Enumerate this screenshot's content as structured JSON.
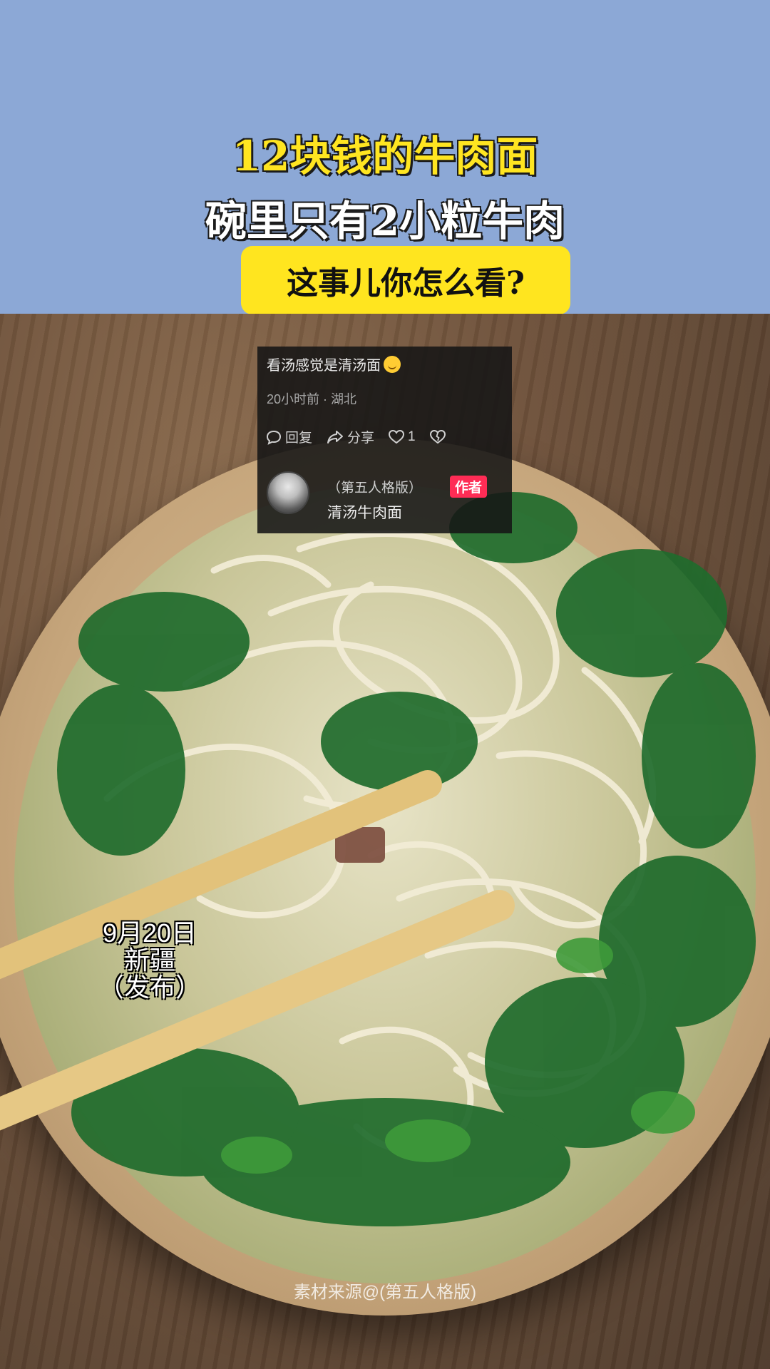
{
  "header": {
    "line1": "12块钱的牛肉面",
    "line2": "碗里只有2小粒牛肉",
    "question": "这事儿你怎么看?"
  },
  "comment": {
    "text": "看汤感觉是清汤面",
    "emoji_icon": "grin-emoji-icon",
    "meta": "20小时前 · 湖北",
    "actions": {
      "reply_label": "回复",
      "share_label": "分享",
      "like_count": "1"
    },
    "reply": {
      "author": "（第五人格版）",
      "badge": "作者",
      "text": "清汤牛肉面"
    }
  },
  "caption": {
    "date": "9月20日",
    "place": "新疆",
    "note": "（发布）"
  },
  "source": "素材来源@(第五人格版)",
  "colors": {
    "header_bg": "#8ca8d6",
    "accent_yellow": "#ffe51f",
    "badge_red": "#fe2c55"
  }
}
